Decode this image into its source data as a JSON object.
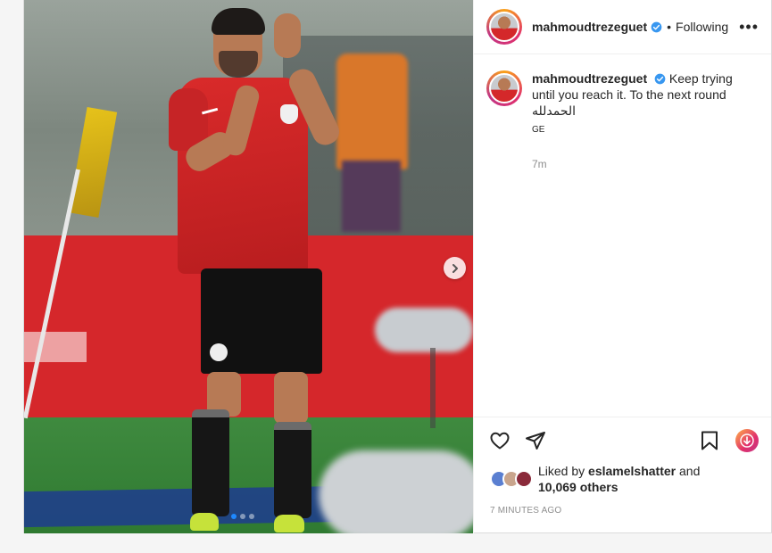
{
  "post": {
    "username": "mahmoudtrezeguet",
    "follow_separator": "•",
    "follow_status": "Following",
    "more_icon_glyph": "•••",
    "caption_text": "Keep trying until you reach it. To the next round الحمدلله",
    "caption_sub": "GE",
    "caption_time": "7m",
    "media_indicator": {
      "current": 1,
      "total": 3
    }
  },
  "likes": {
    "prefix": "Liked by ",
    "first_liker": "eslamelshatter",
    "joiner": " and",
    "others": "10,069 others"
  },
  "posted_time": "7 MINUTES AGO",
  "colors": {
    "accent_blue": "#0095f6",
    "verified_blue": "#3897f0",
    "jersey_red": "#d92a2a",
    "text_primary": "#262626",
    "text_secondary": "#8e8e8e"
  },
  "icons": {
    "like": "heart-icon",
    "share": "paper-plane-icon",
    "save": "bookmark-icon",
    "download": "download-icon",
    "next": "chevron-right-icon",
    "verified": "verified-badge-icon",
    "more": "more-options-icon"
  }
}
